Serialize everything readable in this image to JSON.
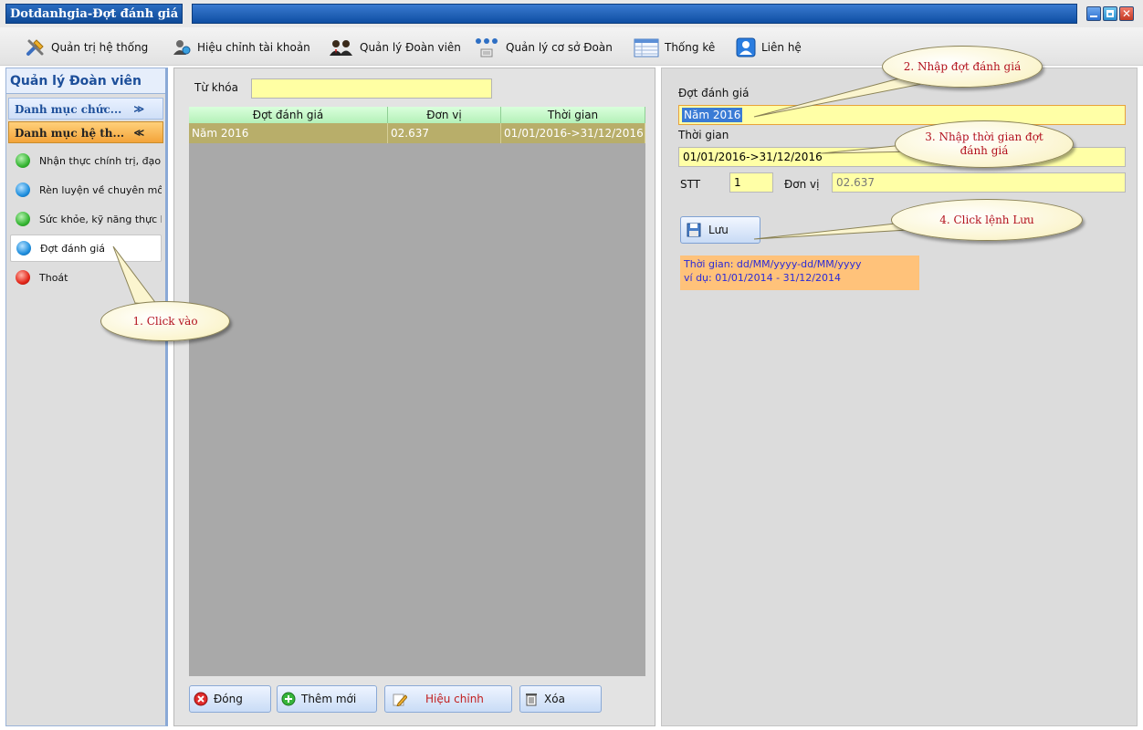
{
  "window": {
    "title": "Dotdanhgia-Đợt đánh giá",
    "close_glyph": "✕"
  },
  "toolbar": {
    "items": [
      {
        "label": "Quản trị hệ thống",
        "icon": "tools-icon"
      },
      {
        "label": "Hiệu chỉnh tài khoản",
        "icon": "user-edit-icon"
      },
      {
        "label": "Quản lý Đoàn viên",
        "icon": "members-icon"
      },
      {
        "label": "Quản lý cơ sở Đoàn",
        "icon": "organization-icon"
      },
      {
        "label": "Thống kê",
        "icon": "statistics-icon"
      },
      {
        "label": "Liên hệ",
        "icon": "contact-icon"
      }
    ]
  },
  "sidebar": {
    "title": "Quản lý Đoàn viên",
    "category_function": {
      "label": "Danh mục chức...",
      "chevron": "≫"
    },
    "category_system": {
      "label": "Danh mục hệ th...",
      "chevron": "≪"
    },
    "items": [
      {
        "label": "Nhận thực chính trị, đạo đ",
        "color": "green"
      },
      {
        "label": "Rèn luyện về chuyên môn",
        "color": "blue"
      },
      {
        "label": "Sức khỏe, kỹ năng thực h",
        "color": "green"
      },
      {
        "label": "Đợt đánh giá",
        "color": "blue",
        "active": true
      },
      {
        "label": "Thoát",
        "color": "red"
      }
    ]
  },
  "list": {
    "keyword_label": "Từ khóa",
    "keyword_value": "",
    "columns": [
      "Đợt đánh giá",
      "Đơn vị",
      "Thời gian"
    ],
    "rows": [
      [
        "Năm 2016",
        "02.637",
        "01/01/2016->31/12/2016"
      ]
    ],
    "buttons": {
      "close": "Đóng",
      "add": "Thêm mới",
      "edit": "Hiệu chỉnh",
      "delete": "Xóa"
    }
  },
  "form": {
    "period_label": "Đợt đánh giá",
    "period_value": "Năm 2016",
    "time_label": "Thời gian",
    "time_value": "01/01/2016->31/12/2016",
    "stt_label": "STT",
    "stt_value": "1",
    "unit_label": "Đơn vị",
    "unit_value": "02.637",
    "save_label": "Lưu",
    "hint_line1": "Thời gian: dd/MM/yyyy-dd/MM/yyyy",
    "hint_line2": "ví dụ: 01/01/2014 - 31/12/2014"
  },
  "callouts": {
    "c1": "1. Click vào",
    "c2": "2. Nhập đợt đánh giá",
    "c3_line1": "3. Nhập thời gian đợt",
    "c3_line2": "đánh giá",
    "c4": "4. Click lệnh Lưu"
  },
  "colors": {
    "accent": "#1d4f9a",
    "input_bg": "#ffffa3",
    "grid_selected": "#b8ae6a",
    "callout_text": "#b3121f"
  }
}
